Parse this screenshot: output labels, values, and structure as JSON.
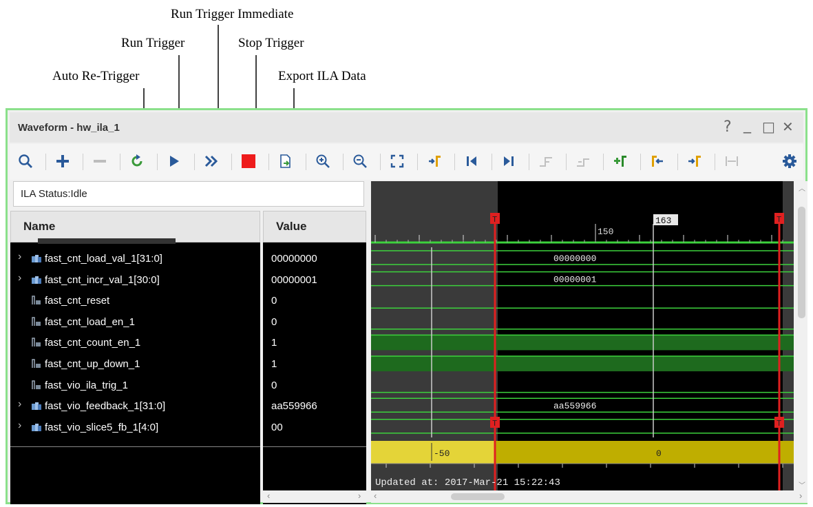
{
  "annotations": {
    "run_trigger_immediate": "Run Trigger Immediate",
    "run_trigger": "Run Trigger",
    "stop_trigger": "Stop Trigger",
    "auto_re_trigger": "Auto Re-Trigger",
    "export_ila_data": "Export ILA Data"
  },
  "window": {
    "title": "Waveform - hw_ila_1",
    "help": "?",
    "minimize": "_",
    "maximize": "□",
    "close": "✕"
  },
  "toolbar_icons": [
    "search-icon",
    "add-icon",
    "remove-icon",
    "auto-retrigger-icon",
    "run-trigger-icon",
    "run-trigger-immediate-icon",
    "stop-trigger-icon",
    "export-icon",
    "zoom-in-icon",
    "zoom-out-icon",
    "zoom-fit-icon",
    "goto-cursor-icon",
    "goto-start-icon",
    "goto-end-icon",
    "prev-transition-icon",
    "next-transition-icon",
    "add-marker-icon",
    "prev-marker-icon",
    "next-marker-icon",
    "swap-cursors-icon",
    "settings-icon"
  ],
  "status": {
    "text": "ILA Status:Idle"
  },
  "columns": {
    "name": "Name",
    "value": "Value"
  },
  "signals": [
    {
      "name": "fast_cnt_load_val_1[31:0]",
      "value": "00000000",
      "bus": true
    },
    {
      "name": "fast_cnt_incr_val_1[30:0]",
      "value": "00000001",
      "bus": true
    },
    {
      "name": "fast_cnt_reset",
      "value": "0",
      "bus": false
    },
    {
      "name": "fast_cnt_load_en_1",
      "value": "0",
      "bus": false
    },
    {
      "name": "fast_cnt_count_en_1",
      "value": "1",
      "bus": false
    },
    {
      "name": "fast_cnt_up_down_1",
      "value": "1",
      "bus": false
    },
    {
      "name": "fast_vio_ila_trig_1",
      "value": "0",
      "bus": false
    },
    {
      "name": "fast_vio_feedback_1[31:0]",
      "value": "aa559966",
      "bus": true
    },
    {
      "name": "fast_vio_slice5_fb_1[4:0]",
      "value": "00",
      "bus": true
    }
  ],
  "waveform": {
    "cursor_label": "163",
    "ruler_label": "150",
    "trigger_marker": "T",
    "bus_labels": [
      "00000000",
      "00000001",
      "aa559966"
    ],
    "sample_labels": [
      "-50",
      "0"
    ],
    "updated": "Updated at: 2017-Mar-21 15:22:43",
    "colors": {
      "wave": "#3cd23c",
      "trigger": "#e02020",
      "sample_bar": "#e4d438"
    }
  }
}
